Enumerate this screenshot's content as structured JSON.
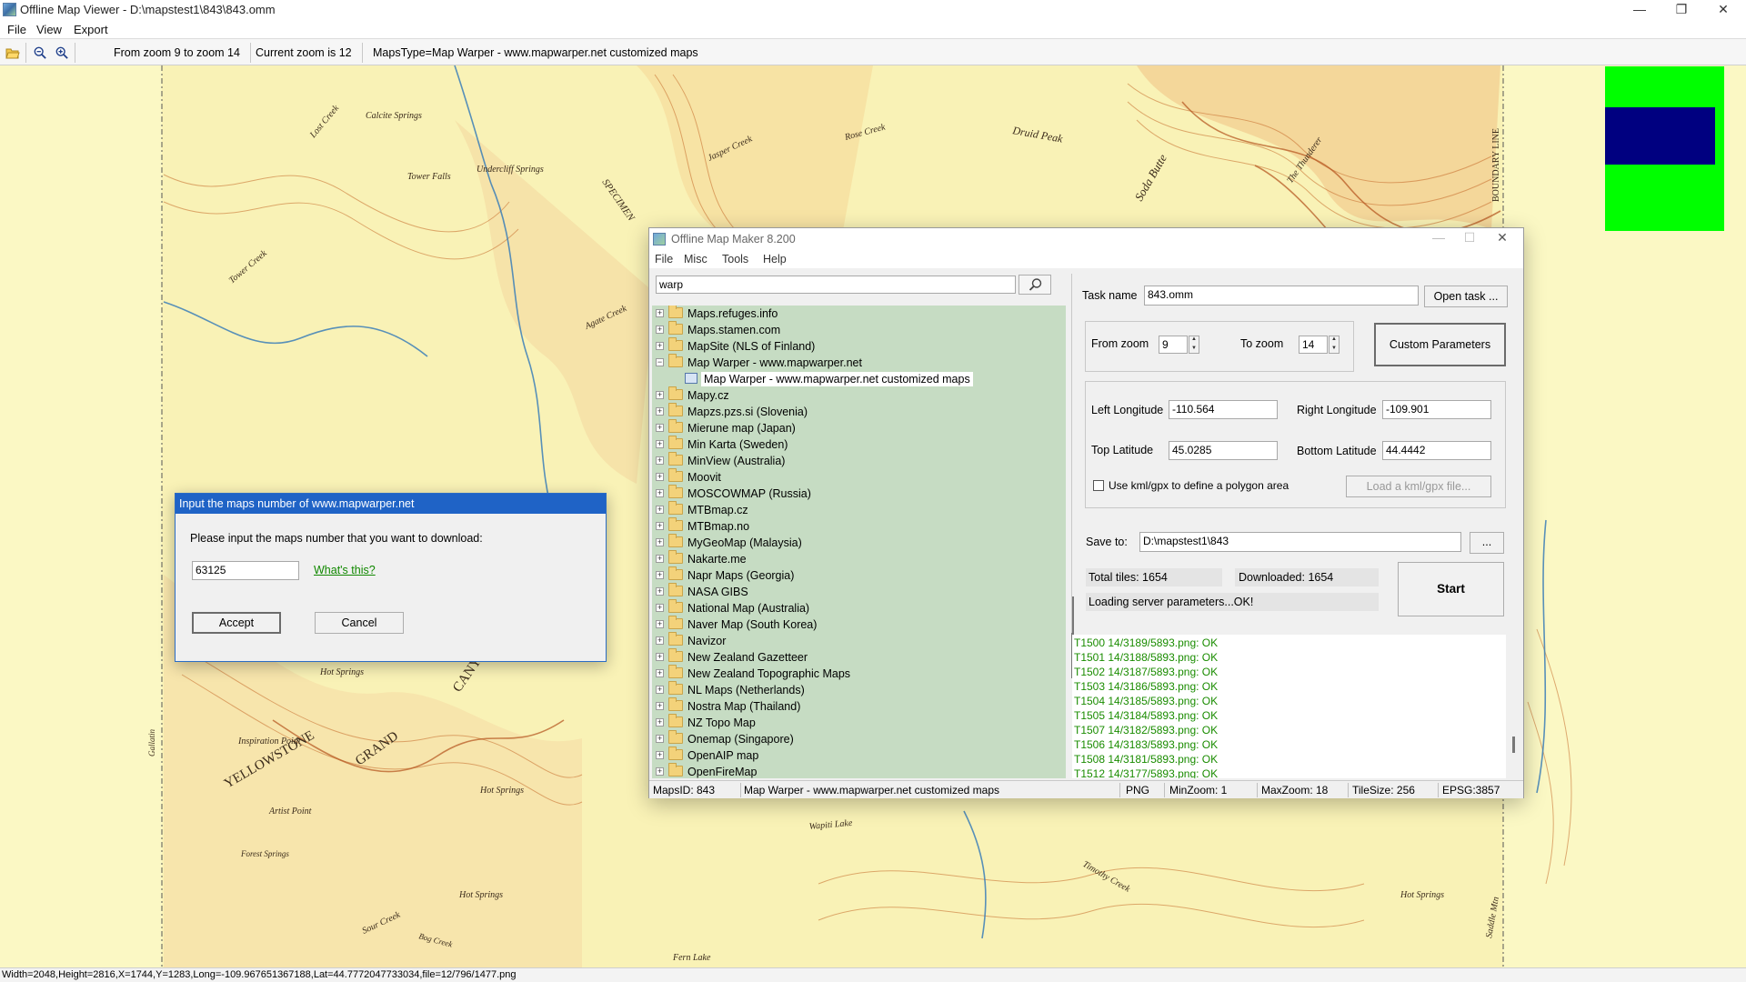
{
  "window": {
    "title": "Offline Map Viewer - D:\\mapstest1\\843\\843.omm",
    "minimize": "—",
    "restore": "❐",
    "close": "✕"
  },
  "menu": [
    "File",
    "View",
    "Export"
  ],
  "toolbar": {
    "zoom_range": "From zoom 9 to zoom 14",
    "current_zoom": "Current zoom is 12",
    "maps_type": "MapsType=Map Warper - www.mapwarper.net customized maps"
  },
  "status_bar": "Width=2048,Height=2816,X=1744,Y=1283,Long=-109.967651367188,Lat=44.7772047733034,file=12/796/1477.png",
  "map_labels": [
    "Calcite Springs",
    "Tower Falls",
    "Undercliff Springs",
    "SPECIMEN",
    "Druid Peak",
    "Rose Creek",
    "Jasper Creek",
    "The Thunderer",
    "Soda Butte",
    "BOUNDARY LINE",
    "Agate Creek",
    "Tower Creek",
    "Lost Creek",
    "Hot Springs",
    "YELLOWSTONE",
    "GRAND",
    "CANYON",
    "Inspiration Point",
    "Artist Point",
    "Hot Springs",
    "Wapiti Lake",
    "Timothy Creek",
    "Forest Springs",
    "Fern Lake",
    "Hot Springs",
    "Saddle Mtn",
    "Hot Springs",
    "Bog Creek",
    "Sour Creek",
    "Gallatin"
  ],
  "colors": {
    "map_bg": "#fbf8c4",
    "tree_bg": "#c6dcc3",
    "log_text": "#1a8c00",
    "dialog_title": "#1f63c6",
    "overview_green": "#00ff00",
    "overview_blue": "#000080"
  },
  "omm": {
    "title": "Offline Map Maker 8.200",
    "menu": [
      "File",
      "Misc",
      "Tools",
      "Help"
    ],
    "search_value": "warp",
    "tree": [
      {
        "label": "Maps.refuges.info",
        "expanded": false
      },
      {
        "label": "Maps.stamen.com",
        "expanded": false
      },
      {
        "label": "MapSite (NLS of Finland)",
        "expanded": false
      },
      {
        "label": "Map Warper - www.mapwarper.net",
        "expanded": true
      },
      {
        "label": "Map Warper - www.mapwarper.net customized maps",
        "child": true,
        "selected": true
      },
      {
        "label": "Mapy.cz",
        "expanded": false
      },
      {
        "label": "Mapzs.pzs.si (Slovenia)",
        "expanded": false
      },
      {
        "label": "Mierune map (Japan)",
        "expanded": false
      },
      {
        "label": "Min Karta (Sweden)",
        "expanded": false
      },
      {
        "label": "MinView (Australia)",
        "expanded": false
      },
      {
        "label": "Moovit",
        "expanded": false
      },
      {
        "label": "MOSCOWMAP (Russia)",
        "expanded": false
      },
      {
        "label": "MTBmap.cz",
        "expanded": false
      },
      {
        "label": "MTBmap.no",
        "expanded": false
      },
      {
        "label": "MyGeoMap (Malaysia)",
        "expanded": false
      },
      {
        "label": "Nakarte.me",
        "expanded": false
      },
      {
        "label": "Napr Maps (Georgia)",
        "expanded": false
      },
      {
        "label": "NASA GIBS",
        "expanded": false
      },
      {
        "label": "National Map (Australia)",
        "expanded": false
      },
      {
        "label": "Naver Map (South Korea)",
        "expanded": false
      },
      {
        "label": "Navizor",
        "expanded": false
      },
      {
        "label": "New Zealand Gazetteer",
        "expanded": false
      },
      {
        "label": "New Zealand Topographic Maps",
        "expanded": false
      },
      {
        "label": "NL Maps (Netherlands)",
        "expanded": false
      },
      {
        "label": "Nostra Map (Thailand)",
        "expanded": false
      },
      {
        "label": "NZ Topo Map",
        "expanded": false
      },
      {
        "label": "Onemap (Singapore)",
        "expanded": false
      },
      {
        "label": "OpenAIP map",
        "expanded": false
      },
      {
        "label": "OpenFireMap",
        "expanded": false
      }
    ],
    "task_name_label": "Task name",
    "task_name_value": "843.omm",
    "open_task": "Open task ...",
    "from_zoom_label": "From zoom",
    "from_zoom_value": "9",
    "to_zoom_label": "To zoom",
    "to_zoom_value": "14",
    "custom_params": "Custom Parameters",
    "left_lon_label": "Left Longitude",
    "left_lon_value": "-110.564",
    "right_lon_label": "Right Longitude",
    "right_lon_value": "-109.901",
    "top_lat_label": "Top Latitude",
    "top_lat_value": "45.0285",
    "bottom_lat_label": "Bottom Latitude",
    "bottom_lat_value": "44.4442",
    "kml_check_label": "Use kml/gpx to define a polygon area",
    "load_kml": "Load a kml/gpx file...",
    "save_to_label": "Save to:",
    "save_to_value": "D:\\mapstest1\\843",
    "browse": "...",
    "total_tiles": "Total tiles: 1654",
    "downloaded": "Downloaded: 1654",
    "loading": "Loading server parameters...OK!",
    "start": "Start",
    "log": [
      "T1500 14/3189/5893.png: OK",
      "T1501 14/3188/5893.png: OK",
      "T1502 14/3187/5893.png: OK",
      "T1503 14/3186/5893.png: OK",
      "T1504 14/3185/5893.png: OK",
      "T1505 14/3184/5893.png: OK",
      "T1507 14/3182/5893.png: OK",
      "T1506 14/3183/5893.png: OK",
      "T1508 14/3181/5893.png: OK",
      "T1512 14/3177/5893.png: OK"
    ],
    "status": {
      "maps_id": "MapsID: 843",
      "maps_name": "Map Warper - www.mapwarper.net customized maps",
      "format": "PNG",
      "min_zoom": "MinZoom: 1",
      "max_zoom": "MaxZoom: 18",
      "tile_size": "TileSize: 256",
      "epsg": "EPSG:3857"
    }
  },
  "dialog": {
    "title": "Input the maps number of www.mapwarper.net",
    "prompt": "Please input the maps number that you want to download:",
    "value": "63125",
    "help_link": "What's this?",
    "accept": "Accept",
    "cancel": "Cancel"
  }
}
